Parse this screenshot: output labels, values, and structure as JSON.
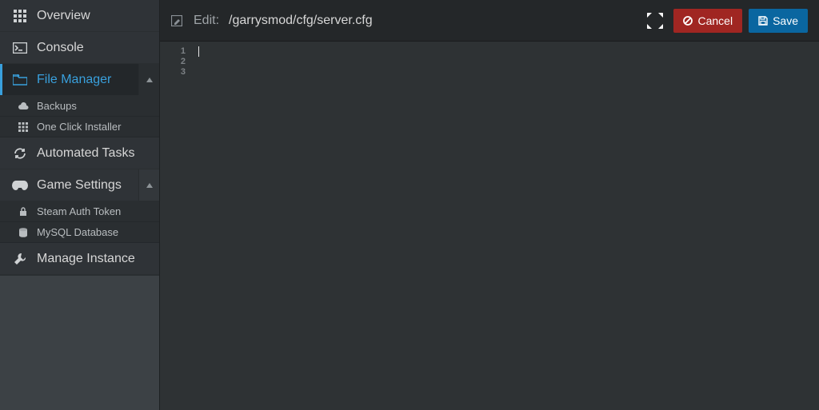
{
  "sidebar": {
    "overview": "Overview",
    "console": "Console",
    "file_manager": "File Manager",
    "file_manager_children": {
      "backups": "Backups",
      "one_click": "One Click Installer"
    },
    "automated_tasks": "Automated Tasks",
    "game_settings": "Game Settings",
    "game_settings_children": {
      "steam_token": "Steam Auth Token",
      "mysql": "MySQL Database"
    },
    "manage_instance": "Manage Instance"
  },
  "toolbar": {
    "edit_label": "Edit:",
    "path": "/garrysmod/cfg/server.cfg",
    "cancel": "Cancel",
    "save": "Save"
  },
  "editor": {
    "line_numbers": [
      "1",
      "2",
      "3"
    ],
    "lines": [
      "",
      "",
      ""
    ]
  }
}
